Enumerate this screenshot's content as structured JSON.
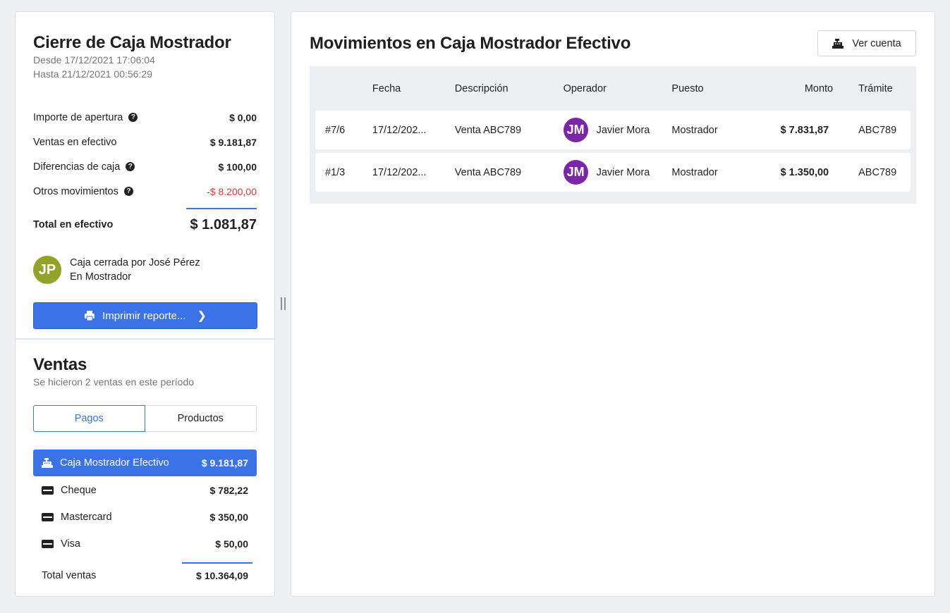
{
  "closing": {
    "title": "Cierre de Caja Mostrador",
    "desde": "Desde 17/12/2021 17:06:04",
    "hasta": "Hasta 21/12/2021 00:56:29",
    "rows": [
      {
        "label": "Importe de apertura",
        "value": "$ 0,00",
        "help": true
      },
      {
        "label": "Ventas en efectivo",
        "value": "$ 9.181,87",
        "help": false
      },
      {
        "label": "Diferencias de caja",
        "value": "$ 100,00",
        "help": true
      },
      {
        "label": "Otros movimientos",
        "value": "-$ 8.200,00",
        "help": true
      }
    ],
    "total_label": "Total en efectivo",
    "total_value": "$ 1.081,87",
    "closed_by_initials": "JP",
    "closed_by_line1": "Caja cerrada por José Pérez",
    "closed_by_line2": "En Mostrador",
    "print_label": "Imprimir reporte...",
    "negative_color": "#d43a3a"
  },
  "sales": {
    "title": "Ventas",
    "subtitle": "Se hicieron 2 ventas en este período",
    "tabs": [
      {
        "label": "Pagos",
        "active": true
      },
      {
        "label": "Productos",
        "active": false
      }
    ],
    "payments": [
      {
        "label": "Caja Mostrador Efectivo",
        "value": "$ 9.181,87",
        "icon": "cash-register-icon",
        "active": true
      },
      {
        "label": "Cheque",
        "value": "$ 782,22",
        "icon": "credit-card-icon",
        "active": false
      },
      {
        "label": "Mastercard",
        "value": "$ 350,00",
        "icon": "credit-card-icon",
        "active": false
      },
      {
        "label": "Visa",
        "value": "$ 50,00",
        "icon": "credit-card-icon",
        "active": false
      }
    ],
    "total_label": "Total ventas",
    "total_value": "$ 10.364,09"
  },
  "movements": {
    "title": "Movimientos en Caja Mostrador Efectivo",
    "ver_cuenta_label": "Ver cuenta",
    "columns": [
      "",
      "Fecha",
      "Descripción",
      "Operador",
      "Puesto",
      "Monto",
      "Trámite"
    ],
    "rows": [
      {
        "id": "#7/6",
        "fecha": "17/12/202...",
        "descripcion": "Venta ABC789",
        "operador_initials": "JM",
        "operador": "Javier Mora",
        "puesto": "Mostrador",
        "monto": "$ 7.831,87",
        "tramite": "ABC789"
      },
      {
        "id": "#1/3",
        "fecha": "17/12/202...",
        "descripcion": "Venta ABC789",
        "operador_initials": "JM",
        "operador": "Javier Mora",
        "puesto": "Mostrador",
        "monto": "$ 1.350,00",
        "tramite": "ABC789"
      }
    ]
  },
  "colors": {
    "accent": "#3b73e6",
    "avatar_jp": "#93a32a",
    "avatar_jm": "#7b26a6"
  }
}
